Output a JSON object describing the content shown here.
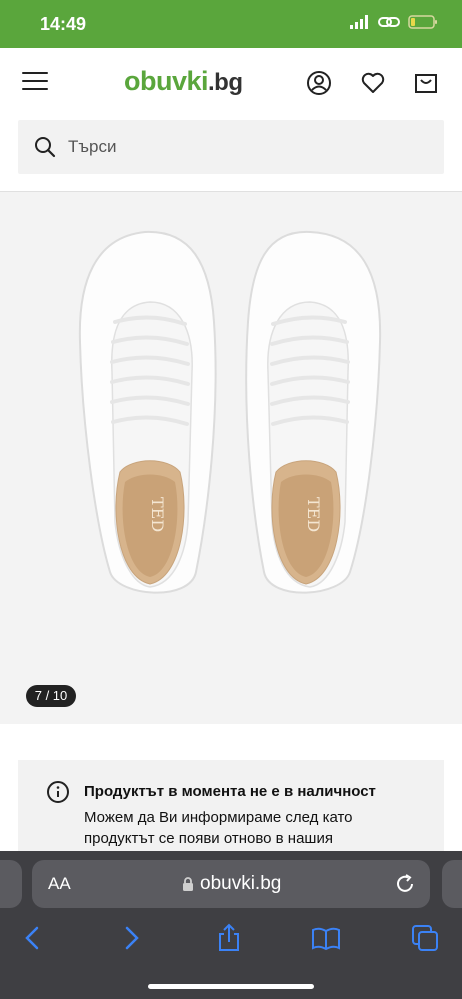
{
  "status_bar": {
    "time": "14:49"
  },
  "header": {
    "logo_main": "obuvki",
    "logo_suffix": ".bg"
  },
  "search": {
    "placeholder": "Търси"
  },
  "gallery": {
    "counter": "7 / 10",
    "brand_print": "TED"
  },
  "notice": {
    "title": "Продуктът в момента не е в наличност",
    "text": "Можем да Ви информираме след като продуктът се появи отново в нашия"
  },
  "browser": {
    "aa_label": "AA",
    "url": "obuvki.bg"
  },
  "colors": {
    "brand_green": "#5aa63c",
    "browser_bar": "#3f3f43",
    "accent_blue": "#3b82f6"
  }
}
